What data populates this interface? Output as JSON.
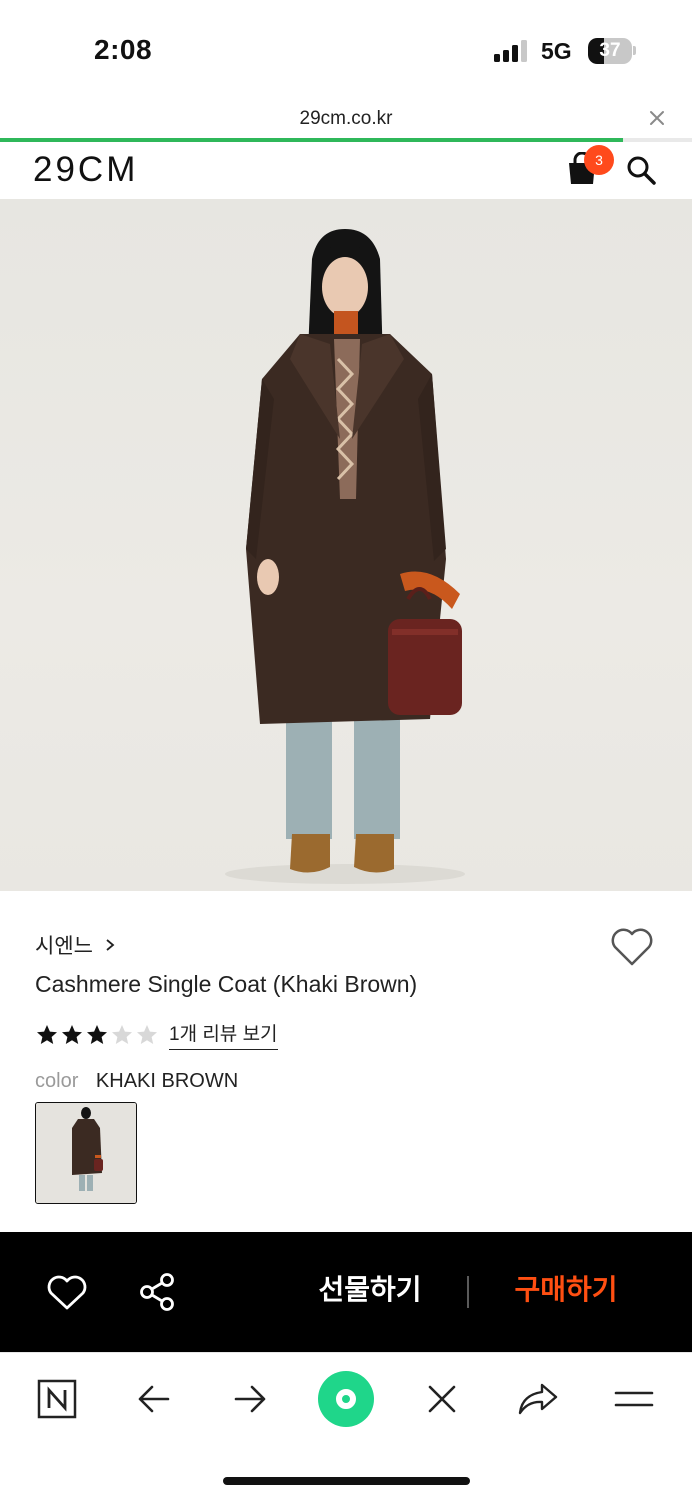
{
  "status_bar": {
    "time": "2:08",
    "network": "5G",
    "battery": "37",
    "battery_level": 0.37
  },
  "browser": {
    "url": "29cm.co.kr",
    "load_progress": 0.9
  },
  "header": {
    "logo": "29CM",
    "cart_count": "3"
  },
  "product": {
    "brand": "시엔느",
    "name": "Cashmere Single Coat (Khaki Brown)",
    "rating": 3,
    "rating_max": 5,
    "review_link": "1개 리뷰 보기",
    "color_label": "color",
    "color_value": "KHAKI BROWN"
  },
  "actions": {
    "gift_label": "선물하기",
    "buy_label": "구매하기"
  },
  "colors": {
    "accent_orange": "#ff4f12",
    "progress_green": "#2fb85a",
    "home_green": "#1fd68a",
    "badge": "#ff4a1c"
  },
  "icons": {
    "signal": "signal-icon",
    "battery": "battery-icon",
    "close": "close-icon",
    "cart": "shopping-bag-icon",
    "search": "search-icon",
    "heart": "heart-icon",
    "share": "share-icon",
    "naver": "naver-n-icon",
    "back": "back-arrow-icon",
    "forward": "forward-arrow-icon",
    "home": "home-circle-icon",
    "menu": "menu-icon"
  }
}
